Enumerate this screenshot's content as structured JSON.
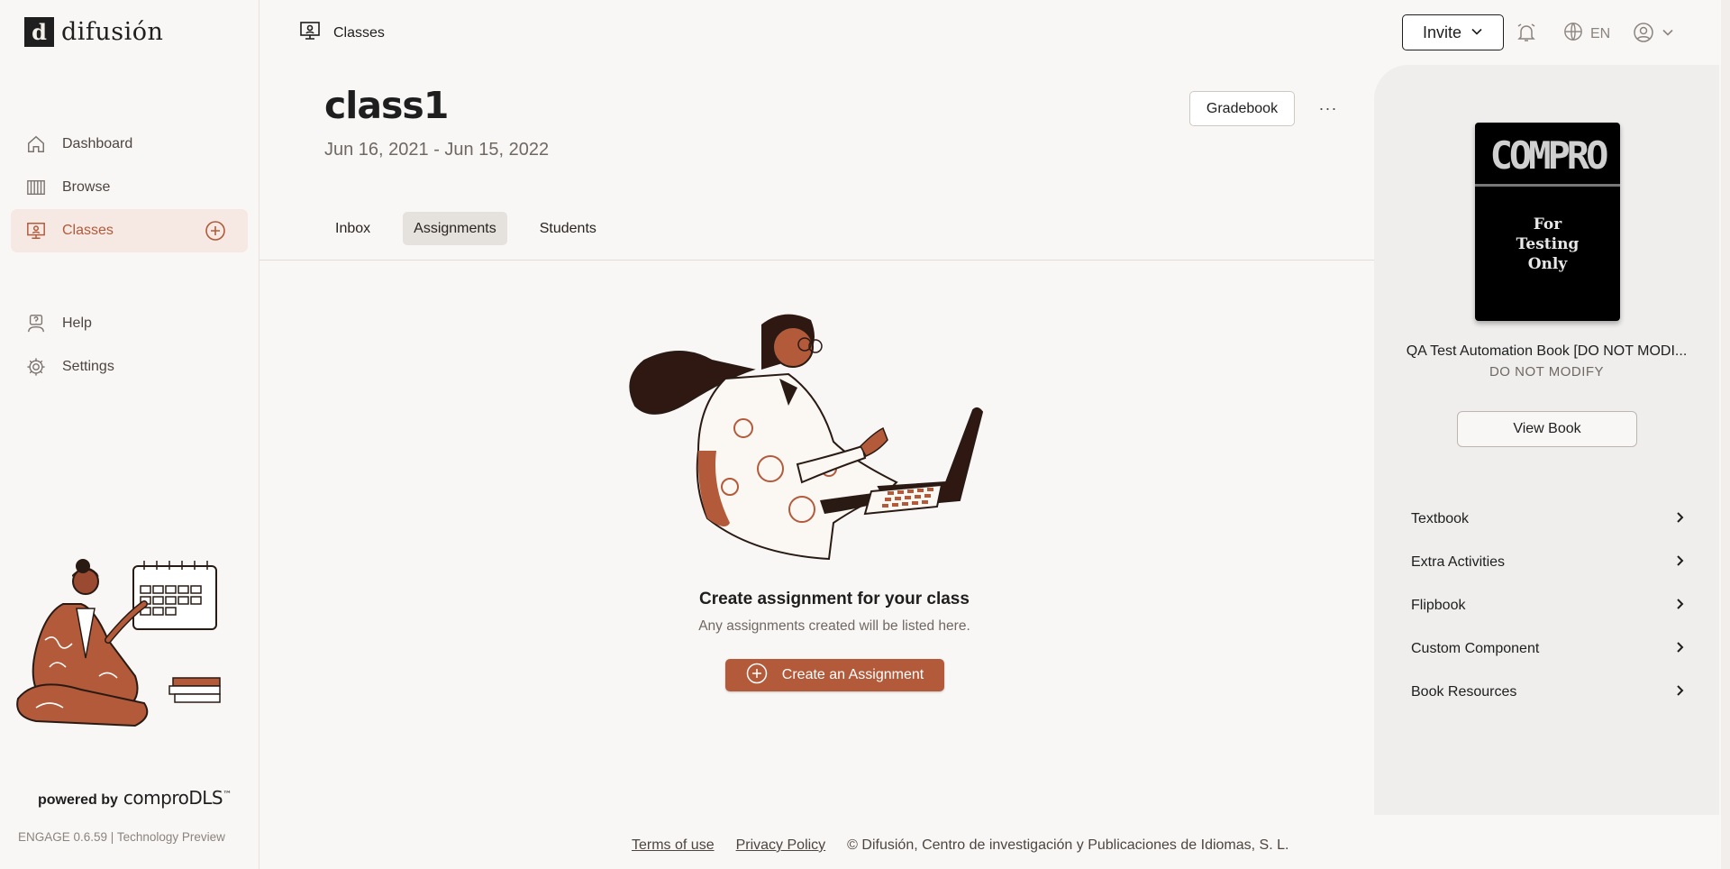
{
  "app": {
    "logo_text": "difusión",
    "logo_letter": "d"
  },
  "sidebar": {
    "items": [
      {
        "label": "Dashboard",
        "icon": "home-icon"
      },
      {
        "label": "Browse",
        "icon": "books-icon"
      },
      {
        "label": "Classes",
        "icon": "classroom-icon",
        "active": true
      },
      {
        "label": "Help",
        "icon": "help-icon"
      },
      {
        "label": "Settings",
        "icon": "gear-icon"
      }
    ],
    "powered_prefix": "powered by",
    "powered_brand": "comproDLS",
    "powered_tm": "™",
    "version": "ENGAGE 0.6.59 | Technology Preview"
  },
  "topbar": {
    "breadcrumb": "Classes",
    "invite_label": "Invite",
    "language": "EN"
  },
  "header": {
    "title": "class1",
    "dates": "Jun 16, 2021 - Jun 15, 2022",
    "gradebook_label": "Gradebook",
    "more_label": "···"
  },
  "tabs": [
    {
      "label": "Inbox"
    },
    {
      "label": "Assignments",
      "active": true
    },
    {
      "label": "Students"
    }
  ],
  "empty_state": {
    "title": "Create assignment for your class",
    "subtitle": "Any assignments created will be listed here.",
    "button_label": "Create an Assignment"
  },
  "footer": {
    "terms": "Terms of use",
    "privacy": "Privacy Policy",
    "copyright": "© Difusión, Centro de investigación y Publicaciones de Idiomas, S. L."
  },
  "book_panel": {
    "cover_title": "COMPRO",
    "cover_subtitle_1": "For",
    "cover_subtitle_2": "Testing",
    "cover_subtitle_3": "Only",
    "name": "QA Test Automation Book [DO NOT MODI...",
    "note": "DO NOT MODIFY",
    "view_label": "View Book",
    "items": [
      {
        "label": "Textbook"
      },
      {
        "label": "Extra Activities"
      },
      {
        "label": "Flipbook"
      },
      {
        "label": "Custom Component"
      },
      {
        "label": "Book Resources"
      }
    ]
  },
  "colors": {
    "accent": "#b35a3b",
    "active_bg": "#f6e8e2",
    "panel_bg": "#efeeed"
  }
}
